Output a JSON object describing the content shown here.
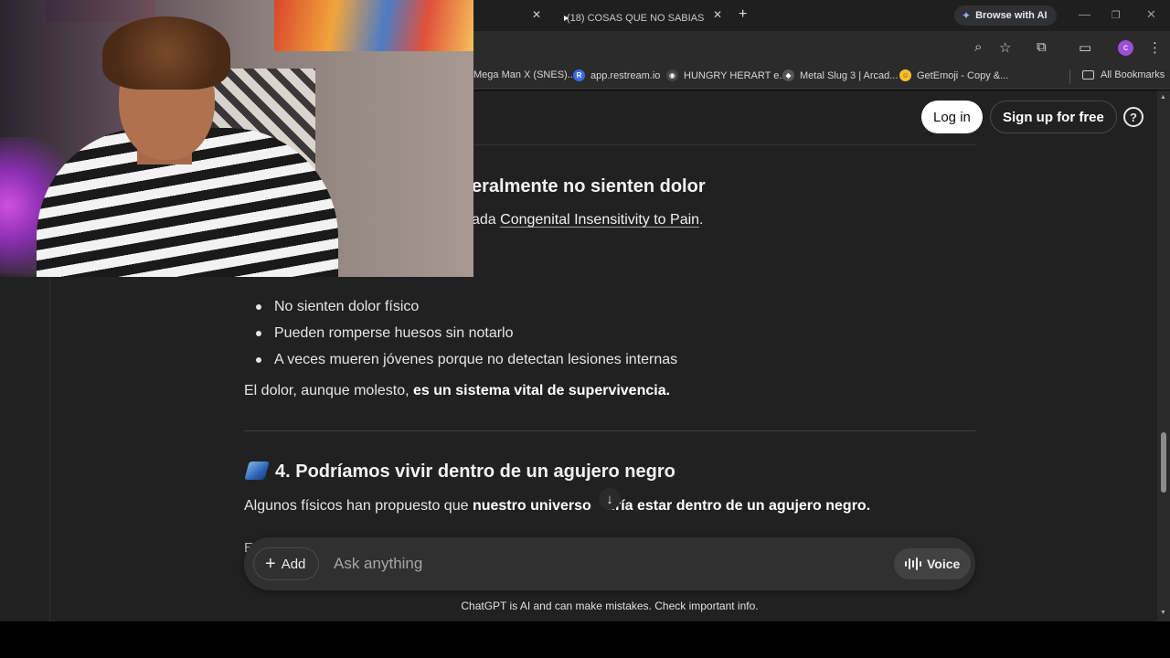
{
  "browser": {
    "tabs": [
      {
        "title": "",
        "active": false
      },
      {
        "title": "(18) COSAS QUE NO SABIAS - \\",
        "active": true
      }
    ],
    "browse_ai_label": "Browse with AI",
    "profile_initial": "c",
    "bookmarks": [
      {
        "label": "Mega Man X (SNES)...",
        "icon": "none"
      },
      {
        "label": "app.restream.io",
        "icon": "R",
        "color": "#3d68e8"
      },
      {
        "label": "HUNGRY HERART e...",
        "icon": "chicken",
        "color": "#444444"
      },
      {
        "label": "Metal Slug 3 | Arcad...",
        "icon": "gamepad",
        "color": "#555555"
      },
      {
        "label": "GetEmoji - Copy &...",
        "icon": "emoji",
        "color": "#f5c02b"
      }
    ],
    "all_bookmarks_label": "All Bookmarks"
  },
  "header": {
    "login_label": "Log in",
    "signup_label": "Sign up for free",
    "help_label": "?"
  },
  "article": {
    "section3_heading_partial": "eralmente no sienten dolor",
    "section3_intro_prefix": "ada ",
    "section3_link": "Congenital Insensitivity to Pain",
    "section3_intro_suffix": ".",
    "bullets": [
      "No sienten dolor físico",
      "Pueden romperse huesos sin notarlo",
      "A veces mueren jóvenes porque no detectan lesiones internas"
    ],
    "summary_plain": "El dolor, aunque molesto, ",
    "summary_bold": "es un sistema vital de supervivencia.",
    "section4_heading": "4. Podríamos vivir dentro de un agujero negro",
    "section4_plain": "Algunos físicos han propuesto que ",
    "section4_bold_a": "nuestro universo ",
    "section4_bold_b": "dría estar dentro de un agujero negro.",
    "cut_line_start": "E"
  },
  "composer": {
    "add_label": "Add",
    "placeholder": "Ask anything",
    "voice_label": "Voice"
  },
  "disclaimer": "ChatGPT is AI and can make mistakes. Check important info.",
  "colors": {
    "page_bg": "#212121",
    "composer_bg": "#303030",
    "login_bg": "#ffffff",
    "profile": "#9b4fd6",
    "youtube": "#ff0033"
  }
}
